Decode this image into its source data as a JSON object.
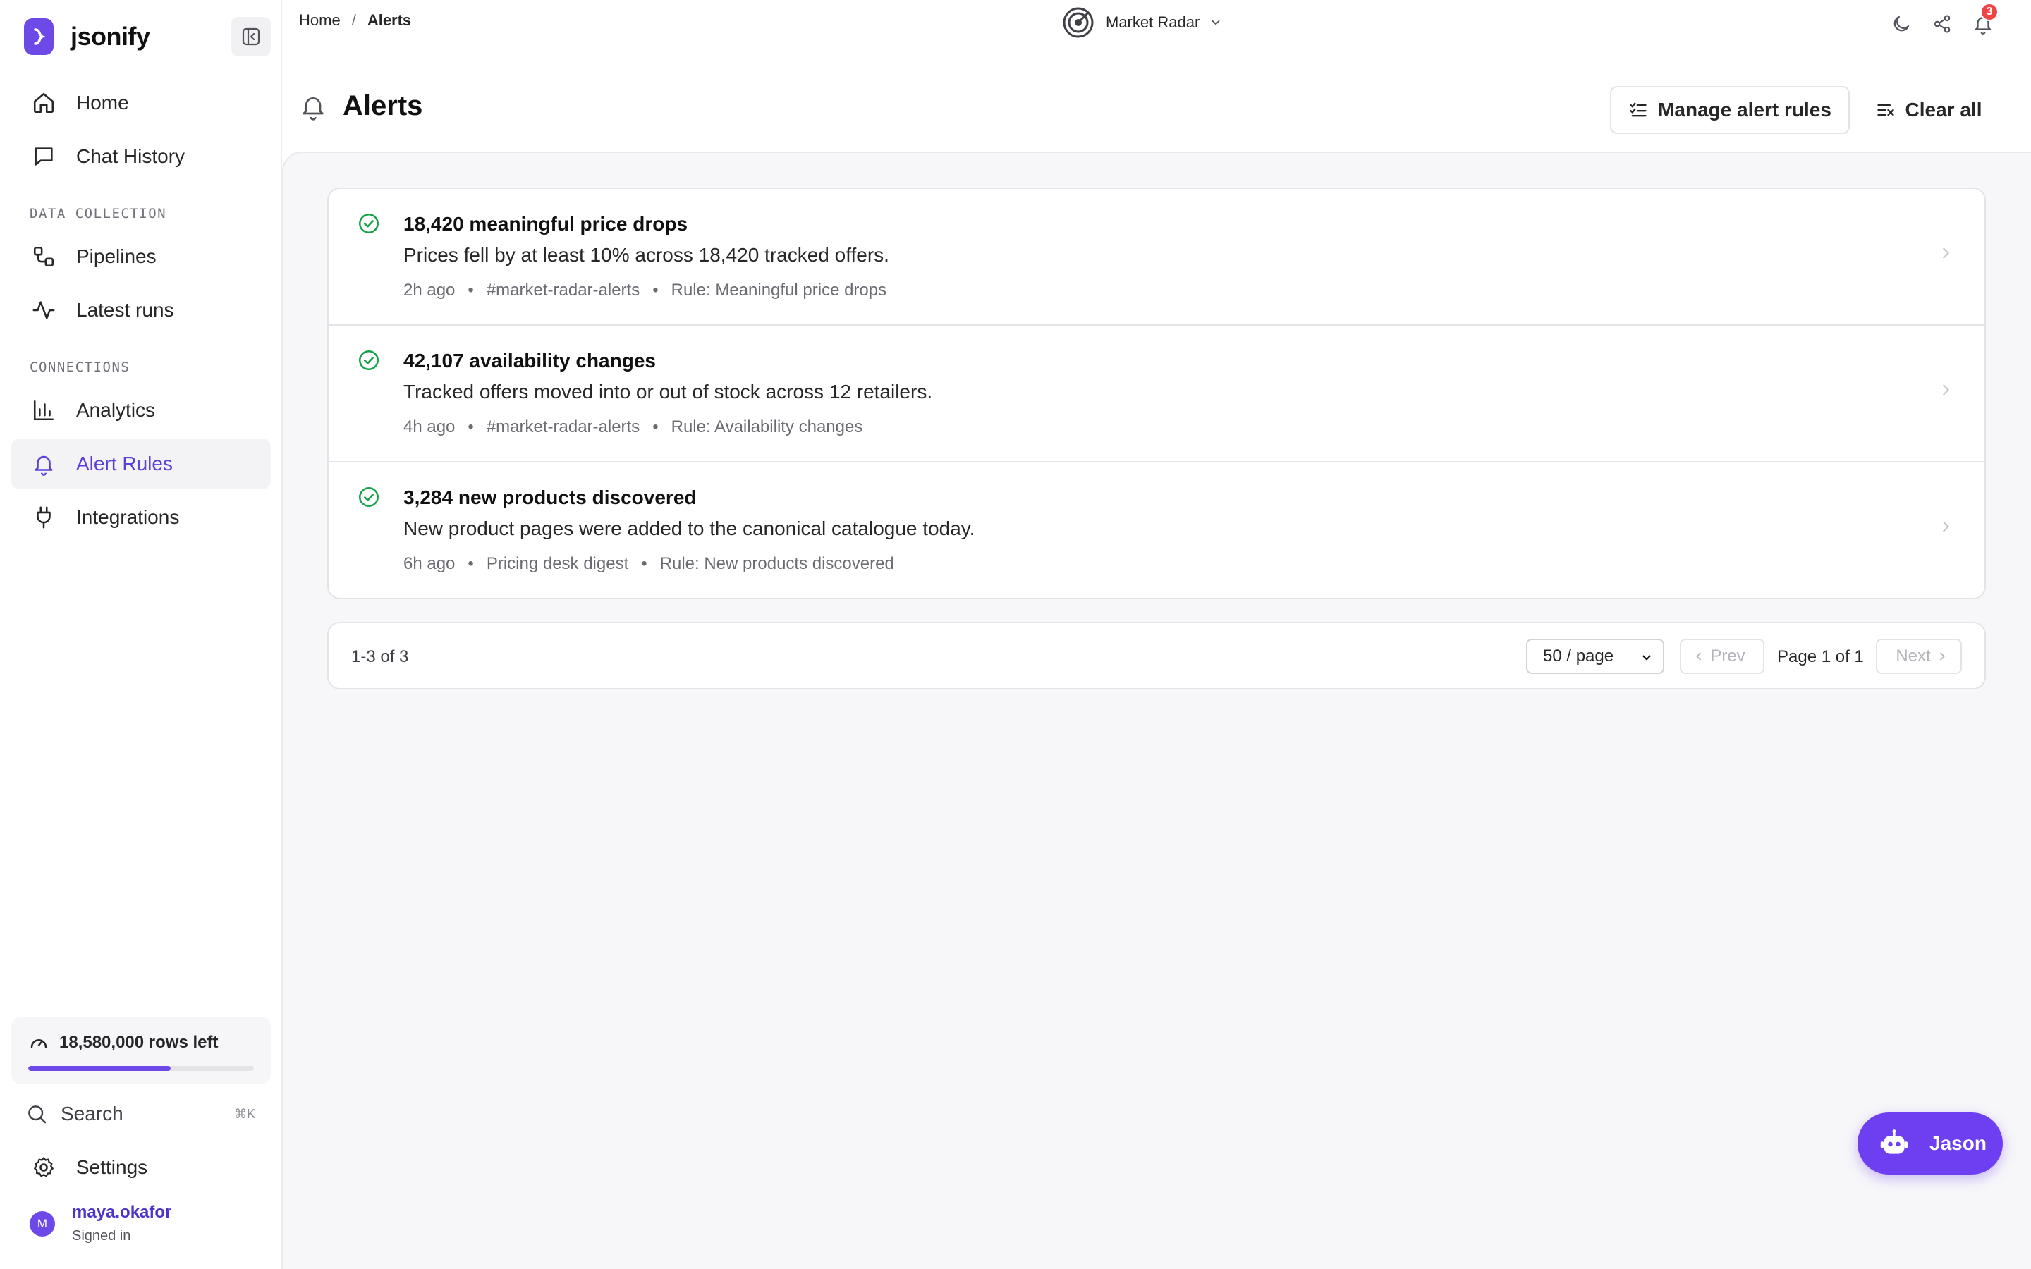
{
  "brand": {
    "name": "jsonify"
  },
  "sidebar": {
    "nav": [
      {
        "label": "Home",
        "icon": "home-icon"
      },
      {
        "label": "Chat History",
        "icon": "chat-icon"
      }
    ],
    "sections": [
      {
        "label": "DATA COLLECTION",
        "items": [
          {
            "label": "Pipelines",
            "icon": "pipelines-icon"
          },
          {
            "label": "Latest runs",
            "icon": "activity-icon"
          }
        ]
      },
      {
        "label": "CONNECTIONS",
        "items": [
          {
            "label": "Analytics",
            "icon": "bar-chart-icon"
          },
          {
            "label": "Alert Rules",
            "icon": "bell-icon",
            "active": true
          },
          {
            "label": "Integrations",
            "icon": "plug-icon"
          }
        ]
      }
    ],
    "usage": {
      "text": "18,580,000 rows left",
      "fraction": 0.63
    },
    "search": {
      "label": "Search",
      "shortcut": "⌘K"
    },
    "settings_label": "Settings",
    "user": {
      "initial": "M",
      "name": "maya.okafor",
      "status": "Signed in"
    }
  },
  "topbar": {
    "breadcrumb": {
      "home": "Home",
      "separator": "/",
      "current": "Alerts"
    },
    "workspace": "Market Radar",
    "notification_count": "3"
  },
  "page": {
    "title": "Alerts",
    "manage_label": "Manage alert rules",
    "clear_label": "Clear all"
  },
  "alerts": [
    {
      "title": "18,420 meaningful price drops",
      "description": "Prices fell by at least 10% across 18,420 tracked offers.",
      "time": "2h ago",
      "channel": "#market-radar-alerts",
      "rule": "Rule: Meaningful price drops"
    },
    {
      "title": "42,107 availability changes",
      "description": "Tracked offers moved into or out of stock across 12 retailers.",
      "time": "4h ago",
      "channel": "#market-radar-alerts",
      "rule": "Rule: Availability changes"
    },
    {
      "title": "3,284 new products discovered",
      "description": "New product pages were added to the canonical catalogue today.",
      "time": "6h ago",
      "channel": "Pricing desk digest",
      "rule": "Rule: New products discovered"
    }
  ],
  "pagination": {
    "range": "1-3 of 3",
    "page_size": "50 / page",
    "prev": "Prev",
    "page_indicator": "Page 1 of 1",
    "next": "Next"
  },
  "chat": {
    "label": "Jason"
  },
  "colors": {
    "accent": "#6d4ae8",
    "success": "#16a34a",
    "badge": "#ef4444"
  }
}
